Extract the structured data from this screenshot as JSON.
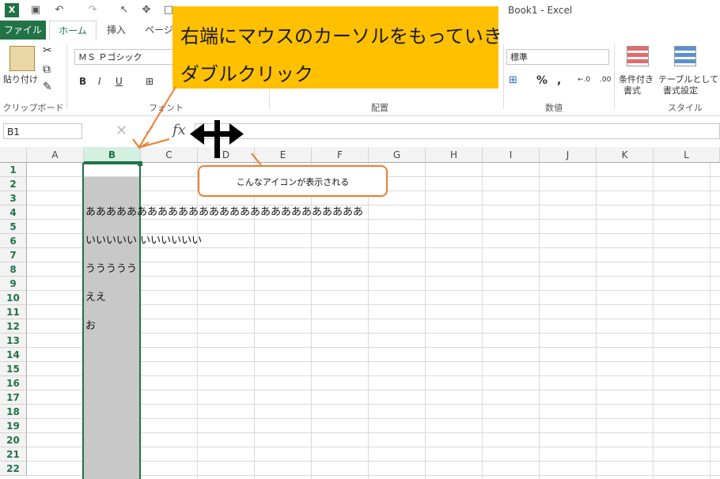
{
  "window": {
    "title": "Book1 - Excel"
  },
  "tabs": [
    "ファイル",
    "ホーム",
    "挿入",
    "ページ"
  ],
  "ribbon": {
    "paste_label": "貼り付け",
    "font_name": "ＭＳ Ｐゴシック",
    "number_format": "標準",
    "percent": "%",
    "comma": ",",
    "cond_format": [
      "条件付き",
      "書式"
    ],
    "table_format": [
      "テーブルとして",
      "書式設定"
    ],
    "groups": {
      "clipboard": "クリップボード",
      "font": "フォント",
      "align": "配置",
      "number": "数値",
      "style": "スタイル"
    },
    "bold": "B",
    "italic": "I",
    "underline": "U"
  },
  "formula_bar": {
    "name_box": "B1",
    "fx": "fx",
    "cancel": "✕",
    "enter": "✓"
  },
  "columns": [
    "A",
    "B",
    "C",
    "D",
    "E",
    "F",
    "G",
    "H",
    "I",
    "J",
    "K",
    "L"
  ],
  "selected_column": "B",
  "rows": [
    "1",
    "2",
    "3",
    "4",
    "5",
    "6",
    "7",
    "8",
    "9",
    "10",
    "11",
    "12",
    "13",
    "14",
    "15",
    "16",
    "17",
    "18",
    "19",
    "20",
    "21",
    "22"
  ],
  "cells": [
    {
      "ref": "B4",
      "value": "あああああああああああああああああああああああああああ"
    },
    {
      "ref": "B6",
      "value": "いいいいい いいいいいい"
    },
    {
      "ref": "B8",
      "value": "ううううう"
    },
    {
      "ref": "B10",
      "value": "ええ"
    },
    {
      "ref": "B12",
      "value": "お"
    }
  ],
  "annotation": {
    "line1": "右端にマウスのカーソルをもっていき",
    "line2": "ダブルクリック",
    "callout": "こんなアイコンが表示される"
  },
  "colors": {
    "excel_green": "#217346",
    "note_bg": "#ffc000",
    "accent_orange": "#ed7d31",
    "selection_fill": "#c8c8c8"
  }
}
